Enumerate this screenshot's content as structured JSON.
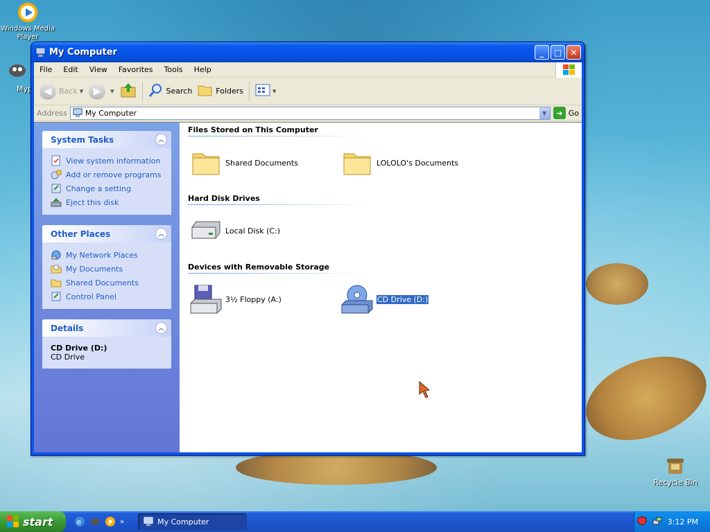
{
  "desktop": {
    "icons": [
      {
        "label": "Windows Media Player",
        "icon": "media-player-icon"
      },
      {
        "label": "Myp",
        "icon": "shortcut-icon"
      },
      {
        "label": "Recycle Bin",
        "icon": "recycle-bin-icon"
      }
    ]
  },
  "window": {
    "title": "My Computer",
    "menu": [
      "File",
      "Edit",
      "View",
      "Favorites",
      "Tools",
      "Help"
    ],
    "toolbar": {
      "back": "Back",
      "search": "Search",
      "folders": "Folders"
    },
    "address": {
      "label": "Address",
      "value": "My Computer",
      "go": "Go"
    },
    "left": {
      "system_tasks": {
        "title": "System Tasks",
        "items": [
          "View system information",
          "Add or remove programs",
          "Change a setting",
          "Eject this disk"
        ]
      },
      "other_places": {
        "title": "Other Places",
        "items": [
          "My Network Places",
          "My Documents",
          "Shared Documents",
          "Control Panel"
        ]
      },
      "details": {
        "title": "Details",
        "name": "CD Drive (D:)",
        "type": "CD Drive"
      }
    },
    "groups": {
      "files": {
        "title": "Files Stored on This Computer",
        "items": [
          "Shared Documents",
          "LOLOLO's Documents"
        ]
      },
      "hdd": {
        "title": "Hard Disk Drives",
        "items": [
          "Local Disk (C:)"
        ]
      },
      "removable": {
        "title": "Devices with Removable Storage",
        "items": [
          "3½ Floppy (A:)",
          "CD Drive (D:)"
        ]
      }
    }
  },
  "taskbar": {
    "start": "start",
    "task_button": "My Computer",
    "clock": "3:12 PM"
  },
  "colors": {
    "xp_blue": "#0b55e6",
    "link_blue": "#215dc6",
    "selection": "#316ac5",
    "start_green": "#3a9a35"
  }
}
